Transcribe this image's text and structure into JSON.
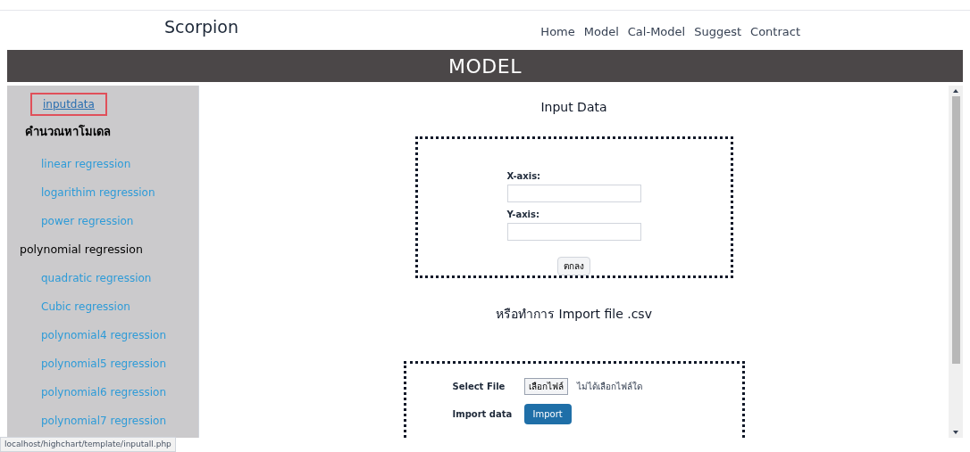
{
  "header": {
    "brand": "Scorpion",
    "nav": [
      "Home",
      "Model",
      "Cal-Model",
      "Suggest",
      "Contract"
    ]
  },
  "banner": {
    "title": "MODEL"
  },
  "sidebar": {
    "top_link": {
      "label": "inputdata",
      "highlighted": true
    },
    "items": [
      {
        "kind": "heading",
        "label": "คำนวณหาโมเดล"
      },
      {
        "kind": "link",
        "label": "linear regression"
      },
      {
        "kind": "link",
        "label": "logarithim regression"
      },
      {
        "kind": "link",
        "label": "power regression"
      },
      {
        "kind": "subheading",
        "label": "polynomial regression"
      },
      {
        "kind": "link",
        "label": "quadratic regression"
      },
      {
        "kind": "link",
        "label": "Cubic regression"
      },
      {
        "kind": "link",
        "label": "polynomial4 regression"
      },
      {
        "kind": "link",
        "label": "polynomial5 regression"
      },
      {
        "kind": "link",
        "label": "polynomial6 regression"
      },
      {
        "kind": "link",
        "label": "polynomial7 regression"
      }
    ]
  },
  "main": {
    "title": "Input Data",
    "fields": [
      {
        "label": "X-axis:"
      },
      {
        "label": "Y-axis:"
      }
    ],
    "submit_button": "ตกลง",
    "import_heading": "หรือทำการ Import file .csv",
    "import": {
      "select_label": "Select File",
      "file_button": "เลือกไฟล์",
      "file_status": "ไม่ได้เลือกไฟล์ใด",
      "import_label": "Import data",
      "import_button": "Import"
    }
  },
  "status_bar": "localhost/highchart/template/inputall.php"
}
